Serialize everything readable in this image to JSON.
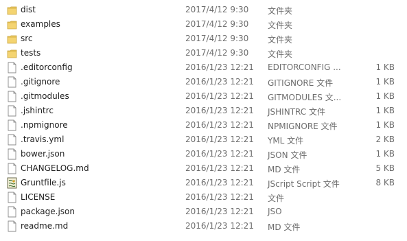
{
  "files": [
    {
      "name": "dist",
      "date": "2017/4/12 9:30",
      "type": "文件夹",
      "size": "",
      "icon": "folder-icon"
    },
    {
      "name": "examples",
      "date": "2017/4/12 9:30",
      "type": "文件夹",
      "size": "",
      "icon": "folder-icon"
    },
    {
      "name": "src",
      "date": "2017/4/12 9:30",
      "type": "文件夹",
      "size": "",
      "icon": "folder-icon"
    },
    {
      "name": "tests",
      "date": "2017/4/12 9:30",
      "type": "文件夹",
      "size": "",
      "icon": "folder-icon"
    },
    {
      "name": ".editorconfig",
      "date": "2016/1/23 12:21",
      "type": "EDITORCONFIG ...",
      "size": "1 KB",
      "icon": "file-icon"
    },
    {
      "name": ".gitignore",
      "date": "2016/1/23 12:21",
      "type": "GITIGNORE 文件",
      "size": "1 KB",
      "icon": "file-icon"
    },
    {
      "name": ".gitmodules",
      "date": "2016/1/23 12:21",
      "type": "GITMODULES 文...",
      "size": "1 KB",
      "icon": "file-icon"
    },
    {
      "name": ".jshintrc",
      "date": "2016/1/23 12:21",
      "type": "JSHINTRC 文件",
      "size": "1 KB",
      "icon": "file-icon"
    },
    {
      "name": ".npmignore",
      "date": "2016/1/23 12:21",
      "type": "NPMIGNORE 文件",
      "size": "1 KB",
      "icon": "file-icon"
    },
    {
      "name": ".travis.yml",
      "date": "2016/1/23 12:21",
      "type": "YML 文件",
      "size": "2 KB",
      "icon": "file-icon"
    },
    {
      "name": "bower.json",
      "date": "2016/1/23 12:21",
      "type": "JSON 文件",
      "size": "1 KB",
      "icon": "file-icon"
    },
    {
      "name": "CHANGELOG.md",
      "date": "2016/1/23 12:21",
      "type": "MD 文件",
      "size": "5 KB",
      "icon": "file-icon"
    },
    {
      "name": "Gruntfile.js",
      "date": "2016/1/23 12:21",
      "type": "JScript Script 文件",
      "size": "8 KB",
      "icon": "jscript-icon"
    },
    {
      "name": "LICENSE",
      "date": "2016/1/23 12:21",
      "type": "文件",
      "size": "",
      "icon": "file-icon"
    },
    {
      "name": "package.json",
      "date": "2016/1/23 12:21",
      "type": "JSO",
      "size": "",
      "icon": "file-icon"
    },
    {
      "name": "readme.md",
      "date": "2016/1/23 12:21",
      "type": "MD 文件",
      "size": "",
      "icon": "file-icon"
    }
  ]
}
